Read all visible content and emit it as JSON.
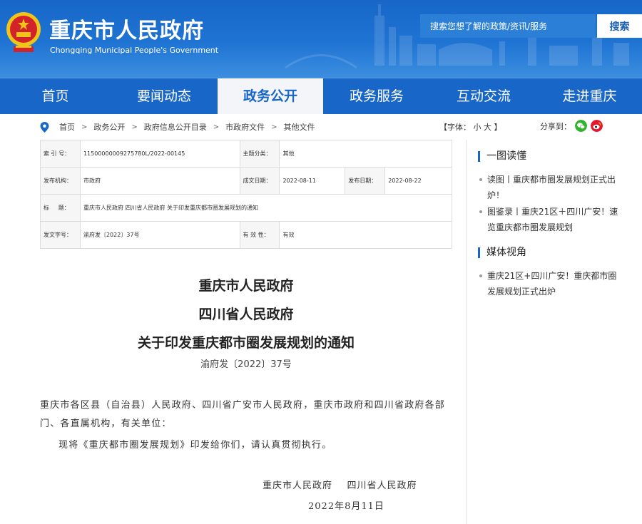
{
  "header": {
    "title": "重庆市人民政府",
    "subtitle": "Chongqing Municipal People's Government",
    "search_placeholder": "搜索您想了解的政策/资讯/服务",
    "search_button": "搜索"
  },
  "nav": {
    "items": [
      "首页",
      "要闻动态",
      "政务公开",
      "政务服务",
      "互动交流",
      "走进重庆"
    ],
    "active": "政务公开"
  },
  "breadcrumb": [
    "首页",
    "政务公开",
    "政府信息公开目录",
    "市政府文件",
    "其他文件"
  ],
  "font_size": {
    "label": "【字体：",
    "small": "小",
    "large": "大",
    "end": "】"
  },
  "share": {
    "label": "分享到：",
    "icons": [
      "wechat-icon",
      "weibo-icon"
    ]
  },
  "meta": {
    "index_label": "索 引 号：",
    "index_value": "11500000009275780L/2022-00145",
    "category_label": "主题分类：",
    "category_value": "其他",
    "publisher_label": "发布机构：",
    "publisher_value": "市政府",
    "created_label": "成文日期：",
    "created_value": "2022-08-11",
    "published_label": "发布日期：",
    "published_value": "2022-08-22",
    "title_label": "标     题：",
    "title_value": "重庆市人民政府 四川省人民政府 关于印发重庆都市圈发展规划的通知",
    "docno_label": "发文字号：",
    "docno_value": "渝府发〔2022〕37号",
    "validity_label": "有 效 性：",
    "validity_value": "有效"
  },
  "document": {
    "title_lines": [
      "重庆市人民政府",
      "四川省人民政府",
      "关于印发重庆都市圈发展规划的通知"
    ],
    "number": "渝府发〔2022〕37号",
    "address": "重庆市各区县（自治县）人民政府、四川省广安市人民政府，重庆市政府和四川省政府各部门、各直属机构，有关单位：",
    "body": "现将《重庆都市圈发展规划》印发给你们，请认真贯彻执行。",
    "signers": "重庆市人民政府    四川省人民政府",
    "date": "2022年8月11日"
  },
  "sidebar": {
    "sections": [
      {
        "heading": "一图读懂",
        "items": [
          "读图丨重庆都市圈发展规划正式出炉！",
          "图鉴录丨重庆21区＋四川广安！速览重庆都市圈发展规划"
        ]
      },
      {
        "heading": "媒体视角",
        "items": [
          "重庆21区+四川广安！重庆都市圈发展规划正式出炉"
        ]
      }
    ]
  },
  "colors": {
    "brand_blue": "#1766c8",
    "nav_active_bg": "#f3f5f8"
  }
}
